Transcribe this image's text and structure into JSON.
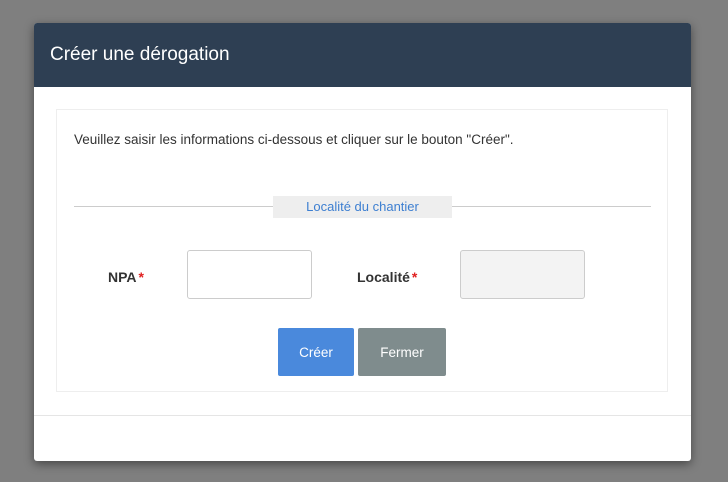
{
  "modal": {
    "title": "Créer une dérogation",
    "intro": "Veuillez saisir les informations ci-dessous et cliquer sur le bouton \"Créer\".",
    "section_label": "Localité du chantier",
    "fields": {
      "npa": {
        "label": "NPA",
        "required_mark": "*",
        "value": ""
      },
      "localite": {
        "label": "Localité",
        "required_mark": "*",
        "value": "",
        "disabled": true
      }
    },
    "buttons": {
      "create": "Créer",
      "close": "Fermer"
    }
  },
  "colors": {
    "header_bg": "#2e3f53",
    "primary": "#4a89dc",
    "secondary": "#7f8c8d",
    "required": "#e02020",
    "section_label": "#3d7fd1"
  }
}
